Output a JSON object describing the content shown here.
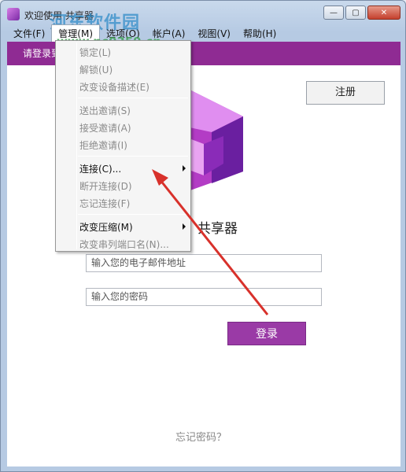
{
  "window": {
    "title": "欢迎使用 共享器",
    "watermark": "河东软件园",
    "watermark_url": "www.pc0359.cn",
    "controls": {
      "minimize": "—",
      "maximize": "▢",
      "close": "✕"
    }
  },
  "menubar": {
    "items": [
      {
        "label": "文件(F)"
      },
      {
        "label": "管理(M)"
      },
      {
        "label": "选项(O)"
      },
      {
        "label": "帐户(A)"
      },
      {
        "label": "视图(V)"
      },
      {
        "label": "帮助(H)"
      }
    ]
  },
  "banner": {
    "text": "请登录到..."
  },
  "register_button": "注册",
  "app_name": "共享器",
  "email_field": {
    "placeholder": "输入您的电子邮件地址"
  },
  "password_field": {
    "placeholder": "输入您的密码"
  },
  "login_button": "登录",
  "forgot_password": "忘记密码？",
  "manage_menu": {
    "items": [
      {
        "label": "锁定(L)",
        "enabled": false
      },
      {
        "label": "解锁(U)",
        "enabled": false
      },
      {
        "label": "改变设备描述(E)",
        "enabled": false
      },
      {
        "label": "送出邀请(S)",
        "enabled": false
      },
      {
        "label": "接受邀请(A)",
        "enabled": false
      },
      {
        "label": "拒绝邀请(I)",
        "enabled": false
      },
      {
        "label": "连接(C)...",
        "enabled": true,
        "submenu": true
      },
      {
        "label": "断开连接(D)",
        "enabled": false
      },
      {
        "label": "忘记连接(F)",
        "enabled": false
      },
      {
        "label": "改变压缩(M)",
        "enabled": true,
        "submenu": true
      },
      {
        "label": "改变串列端口名(N)...",
        "enabled": false
      }
    ]
  },
  "colors": {
    "accent": "#9a3aa6",
    "banner": "#8f2b93",
    "annotation_arrow": "#d8312b"
  }
}
